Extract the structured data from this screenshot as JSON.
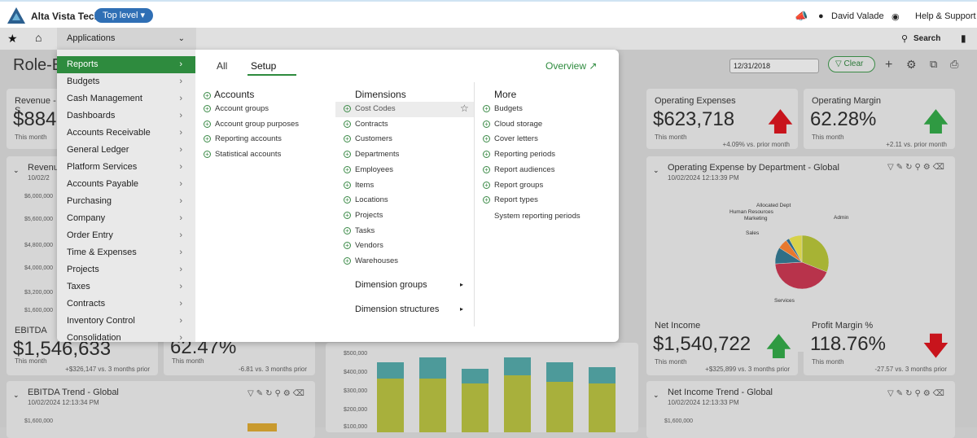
{
  "header": {
    "company": "Alta Vista Tech",
    "top_level": "Top level",
    "user": "David Valade",
    "help": "Help & Support"
  },
  "navbar": {
    "applications": "Applications",
    "search": "Search"
  },
  "page": {
    "title": "Role-B",
    "date_value": "12/31/2018",
    "clear_label": "Clear"
  },
  "cards": {
    "revenue": {
      "title": "Revenue - S",
      "value": "$884",
      "sub": "This month"
    },
    "opex": {
      "title": "Operating Expenses",
      "value": "$623,718",
      "sub": "This month",
      "change": "+4.09% vs. prior month"
    },
    "margin": {
      "title": "Operating Margin",
      "value": "62.28%",
      "sub": "This month",
      "change": "+2.11 vs. prior month"
    },
    "revenue_chart": {
      "title": "Revenu",
      "date": "10/02/2"
    },
    "opex_dept": {
      "title": "Operating Expense by Department - Global",
      "date": "10/02/2024 12:13:39 PM"
    },
    "ebitda": {
      "title": "EBITDA",
      "value": "$1,546,633",
      "sub": "This month",
      "change": "+$326,147 vs. 3 months prior"
    },
    "mid": {
      "value": "62.47%",
      "sub": "This month",
      "change": "-6.81 vs. 3 months prior"
    },
    "net_income": {
      "title": "Net Income",
      "value": "$1,540,722",
      "sub": "This month",
      "change": "+$325,899 vs. 3 months prior"
    },
    "profit_margin": {
      "title": "Profit Margin %",
      "value": "118.76%",
      "sub": "This month",
      "change": "-27.57 vs. 3 months prior"
    },
    "ebitda_trend": {
      "title": "EBITDA Trend - Global",
      "date": "10/02/2024 12:13:34 PM",
      "tick": "$1,600,000"
    },
    "net_income_trend": {
      "title": "Net Income Trend - Global",
      "date": "10/02/2024 12:13:33 PM",
      "tick": "$1,600,000"
    }
  },
  "revenue_ticks": [
    "$6,000,000",
    "$5,600,000",
    "$4,800,000",
    "$4,000,000",
    "$3,200,000",
    "$1,600,000"
  ],
  "mid_ticks": [
    "$500,000",
    "$400,000",
    "$300,000",
    "$200,000",
    "$100,000"
  ],
  "pie_labels": {
    "allocated": "Allocated Dept",
    "hr": "Human Resources",
    "marketing": "Marketing",
    "sales": "Sales",
    "admin": "Admin",
    "services": "Services"
  },
  "chart_data": {
    "type": "pie",
    "title": "Operating Expense by Department - Global",
    "categories": [
      "Admin",
      "Services",
      "Sales",
      "Marketing",
      "Human Resources",
      "Allocated Dept"
    ],
    "values": [
      31,
      43,
      10,
      6,
      2,
      8
    ]
  },
  "menu": {
    "left_items": [
      "Reports",
      "Budgets",
      "Cash Management",
      "Dashboards",
      "Accounts Receivable",
      "General Ledger",
      "Platform Services",
      "Accounts Payable",
      "Purchasing",
      "Company",
      "Order Entry",
      "Time & Expenses",
      "Projects",
      "Taxes",
      "Contracts",
      "Inventory Control",
      "Consolidation"
    ],
    "tabs": [
      "All",
      "Setup"
    ],
    "overview": "Overview",
    "accounts": {
      "title": "Accounts",
      "items": [
        "Account groups",
        "Account group purposes",
        "Reporting accounts",
        "Statistical accounts"
      ]
    },
    "dimensions": {
      "title": "Dimensions",
      "items": [
        "Cost Codes",
        "Contracts",
        "Customers",
        "Departments",
        "Employees",
        "Items",
        "Locations",
        "Projects",
        "Tasks",
        "Vendors",
        "Warehouses"
      ],
      "groups": "Dimension groups",
      "structures": "Dimension structures"
    },
    "more": {
      "title": "More",
      "items": [
        "Budgets",
        "Cloud storage",
        "Cover letters",
        "Reporting periods",
        "Report audiences",
        "Report groups",
        "Report types"
      ],
      "plain_item": "System reporting periods"
    }
  }
}
